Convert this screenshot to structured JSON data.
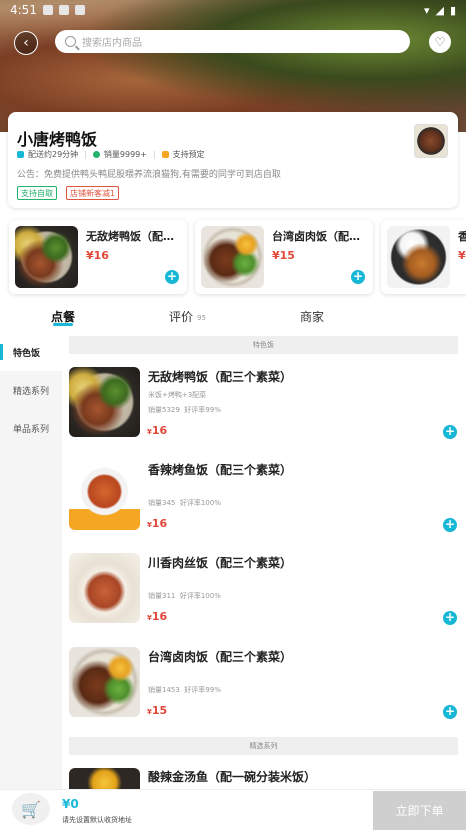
{
  "status_bar": {
    "time": "4:51"
  },
  "header": {
    "search_placeholder": "搜索店内商品"
  },
  "shop": {
    "name": "小唐烤鸭饭",
    "delivery_time": "配送约29分钟",
    "sales": "销量9999+",
    "reservation": "支持预定",
    "notice": "公告：免费提供鸭头鸭屁股喂养流浪猫狗,有需要的同学可到店自取",
    "tags": [
      "支持自取",
      "店铺新客减1"
    ]
  },
  "recommended": [
    {
      "name": "无敌烤鸭饭（配…",
      "price": "¥16",
      "image": "roast-duck-rice"
    },
    {
      "name": "台湾卤肉饭（配…",
      "price": "¥15",
      "image": "braised-pork-rice"
    },
    {
      "name": "香…",
      "price": "¥",
      "image": "pork-cutlet-rice"
    }
  ],
  "tabs": {
    "order": "点餐",
    "reviews": "评价",
    "reviews_count": "95",
    "merchant": "商家"
  },
  "sidebar": {
    "items": [
      {
        "label": "特色饭",
        "active": true
      },
      {
        "label": "精选系列",
        "active": false
      },
      {
        "label": "单品系列",
        "active": false
      }
    ]
  },
  "sections": [
    {
      "title": "特色饭"
    },
    {
      "title": "精选系列"
    }
  ],
  "dishes": [
    {
      "name": "无敌烤鸭饭（配三个素菜）",
      "desc": "米饭+烤鸭+3配菜",
      "sales": "销量5329",
      "rating": "好评率99%",
      "price_symbol": "¥",
      "price": "16",
      "image": "roast-duck-rice"
    },
    {
      "name": "香辣烤鱼饭（配三个素菜）",
      "desc": "",
      "sales": "销量345",
      "rating": "好评率100%",
      "price_symbol": "¥",
      "price": "16",
      "image": "spicy-fish-rice"
    },
    {
      "name": "川香肉丝饭（配三个素菜）",
      "desc": "",
      "sales": "销量311",
      "rating": "好评率100%",
      "price_symbol": "¥",
      "price": "16",
      "image": "shredded-pork-rice"
    },
    {
      "name": "台湾卤肉饭（配三个素菜）",
      "desc": "",
      "sales": "销量1453",
      "rating": "好评率99%",
      "price_symbol": "¥",
      "price": "15",
      "image": "braised-pork-rice"
    },
    {
      "name": "酸辣金汤鱼（配一碗分装米饭）",
      "image": "golden-soup-fish"
    }
  ],
  "cart": {
    "total": "¥0",
    "address_hint": "请先设置默认收货地址",
    "order_button": "立即下单"
  },
  "colors": {
    "accent": "#17b8d6",
    "price": "#e2483a",
    "green_tag": "#21b36b"
  }
}
